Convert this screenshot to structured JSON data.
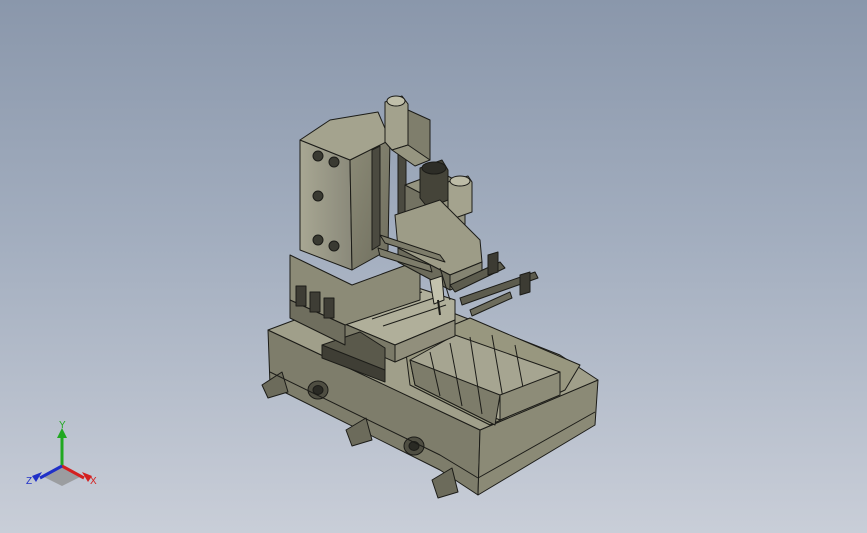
{
  "viewport": {
    "background_top": "#8a97ab",
    "background_bottom": "#c9ced8"
  },
  "model": {
    "body_color": "#8f8e79",
    "shadow_color": "#5e5d4f",
    "highlight_color": "#b5b49f",
    "edge_color": "#1c1c18"
  },
  "triad": {
    "x_label": "X",
    "y_label": "Y",
    "z_label": "Z",
    "x_color": "#d42020",
    "y_color": "#21a821",
    "z_color": "#2030c8"
  }
}
